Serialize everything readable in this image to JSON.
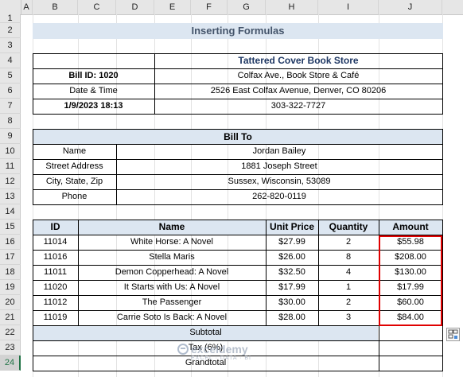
{
  "columns": [
    "A",
    "B",
    "C",
    "D",
    "E",
    "F",
    "G",
    "H",
    "I",
    "J"
  ],
  "rows": [
    "1",
    "2",
    "3",
    "4",
    "5",
    "6",
    "7",
    "8",
    "9",
    "10",
    "11",
    "12",
    "13",
    "14",
    "15",
    "16",
    "17",
    "18",
    "19",
    "20",
    "21",
    "22",
    "23",
    "24"
  ],
  "title": "Inserting Formulas",
  "store": {
    "name": "Tattered Cover Book Store",
    "bill_id": "Bill ID: 1020",
    "address1": "Colfax Ave., Book Store & Café",
    "date_label": "Date & Time",
    "address2": "2526 East Colfax Avenue, Denver, CO 80206",
    "datetime": "1/9/2023 18:13",
    "phone": "303-322-7727"
  },
  "bill_to": {
    "header": "Bill To",
    "name_label": "Name",
    "name": "Jordan Bailey",
    "street_label": "Street Address",
    "street": "1881 Joseph Street",
    "city_label": "City, State, Zip",
    "city": "Sussex, Wisconsin, 53089",
    "phone_label": "Phone",
    "phone": "262-820-0119"
  },
  "items_table": {
    "headers": [
      "ID",
      "Name",
      "Unit Price",
      "Quantity",
      "Amount"
    ],
    "rows": [
      [
        "11014",
        "White Horse: A Novel",
        "$27.99",
        "2",
        "$55.98"
      ],
      [
        "11016",
        "Stella Maris",
        "$26.00",
        "8",
        "$208.00"
      ],
      [
        "11011",
        "Demon Copperhead: A Novel",
        "$32.50",
        "4",
        "$130.00"
      ],
      [
        "11020",
        "It Starts with Us: A Novel",
        "$17.99",
        "1",
        "$17.99"
      ],
      [
        "11012",
        "The Passenger",
        "$30.00",
        "2",
        "$60.00"
      ],
      [
        "11019",
        "Carrie Soto Is Back: A Novel",
        "$28.00",
        "3",
        "$84.00"
      ]
    ],
    "subtotal_label": "Subtotal",
    "tax_label": "Tax (6%)",
    "grandtotal_label": "Grandtotal"
  },
  "watermark": {
    "brand": "exceldemy",
    "tagline": "EXCEL · DATA · BI"
  },
  "icons": {
    "quick_analysis": "quick-analysis-icon"
  }
}
